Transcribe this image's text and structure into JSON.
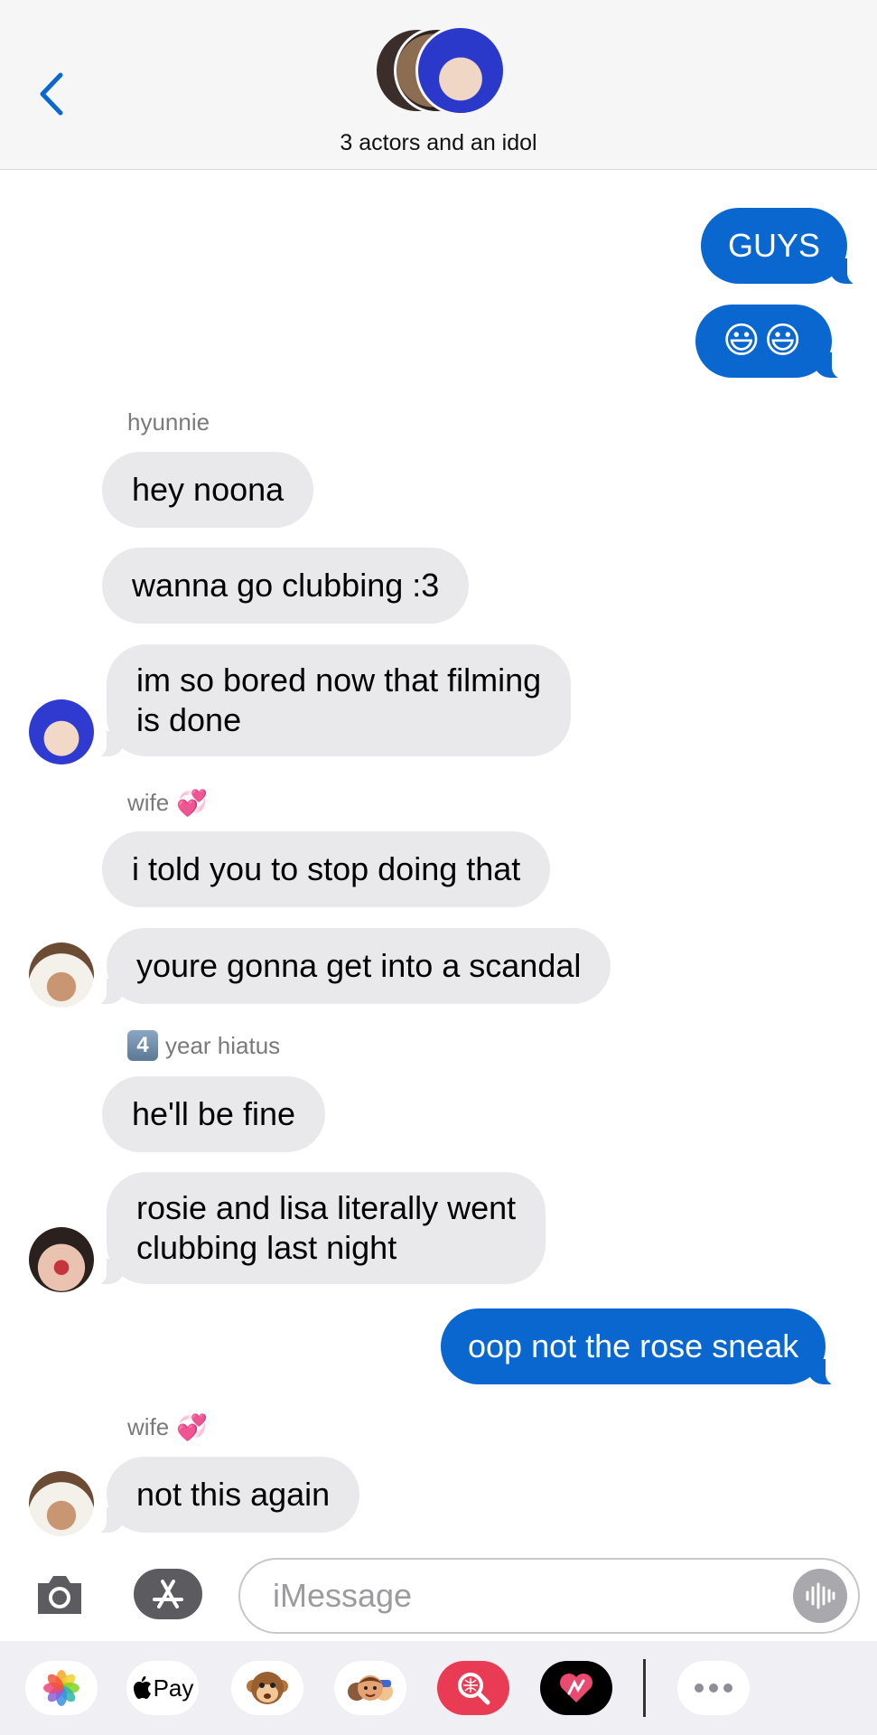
{
  "header": {
    "group_name": "3 actors and an idol"
  },
  "messages": [
    {
      "id": 1,
      "direction": "outgoing",
      "text": "GUYS"
    },
    {
      "id": 2,
      "direction": "outgoing",
      "text": "😃😃"
    },
    {
      "id": 3,
      "direction": "incoming",
      "sender": "hyunnie",
      "text": "hey noona"
    },
    {
      "id": 4,
      "direction": "incoming",
      "sender": "hyunnie",
      "text": "wanna go clubbing :3"
    },
    {
      "id": 5,
      "direction": "incoming",
      "sender": "hyunnie",
      "text_line1": "im so bored now that filming",
      "text_line2": "is done"
    },
    {
      "id": 6,
      "direction": "incoming",
      "sender": "wife 💞",
      "text": "i told you to stop doing that"
    },
    {
      "id": 7,
      "direction": "incoming",
      "sender": "wife 💞",
      "text": "youre gonna get into a scandal"
    },
    {
      "id": 8,
      "direction": "incoming",
      "sender": "4️⃣ year hiatus",
      "text": "he'll be fine"
    },
    {
      "id": 9,
      "direction": "incoming",
      "sender": "4️⃣ year hiatus",
      "text_line1": "rosie and lisa literally went",
      "text_line2": "clubbing last night"
    },
    {
      "id": 10,
      "direction": "outgoing",
      "text": "oop not the rose sneak"
    },
    {
      "id": 11,
      "direction": "incoming",
      "sender": "wife 💞",
      "text": "not this again"
    }
  ],
  "sender_labels": {
    "hyunnie": "hyunnie",
    "wife": "wife",
    "wife_emoji": "💞",
    "hiatus_number": "4",
    "hiatus_text": "year hiatus"
  },
  "input": {
    "placeholder": "iMessage"
  },
  "app_drawer": {
    "apple_pay_label": "Pay",
    "items": [
      "photos-icon",
      "apple-pay-icon",
      "monkey-animoji-icon",
      "memoji-icon",
      "search-images-icon",
      "digital-touch-icon",
      "more-icon"
    ]
  },
  "colors": {
    "outgoing_bubble": "#0a67d0",
    "incoming_bubble": "#e9e9eb",
    "accent": "#0a67d0"
  }
}
